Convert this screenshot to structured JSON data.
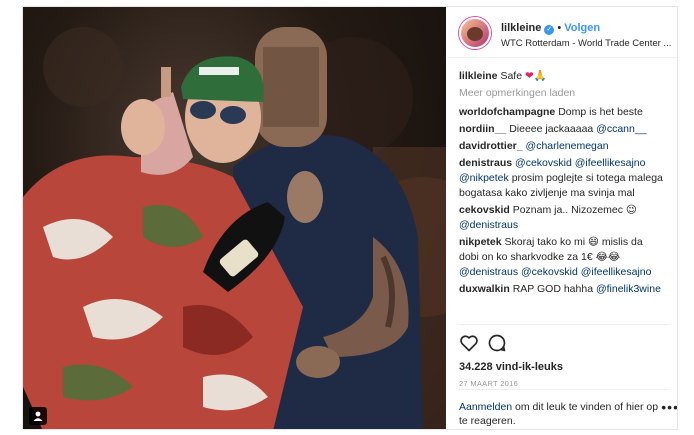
{
  "header": {
    "username": "lilkleine",
    "verified_glyph": "✓",
    "separator": "•",
    "follow_label": "Volgen",
    "location": "WTC Rotterdam - World Trade Center ..."
  },
  "caption": {
    "user": "lilkleine",
    "text": "Safe",
    "heart": "❤",
    "emoji": "🙏"
  },
  "load_more_label": "Meer opmerkingen laden",
  "comments": [
    {
      "user": "worldofchampagne",
      "text": "Domp is het beste"
    },
    {
      "user": "nordiin__",
      "text": "Dieeee jackaaaaa ",
      "mention": "@ccann__"
    },
    {
      "user": "davidrottier_",
      "text": "",
      "mention": "@charlenemegan"
    },
    {
      "user": "denistraus",
      "mention": "@cekovskid @ifeellikesajno @nikpetek",
      "text": " prosim poglejte si totega malega bogatasa kako zivljenje ma svinja mal"
    },
    {
      "user": "cekovskid",
      "text": "Poznam ja.. Nizozemec 😉 ",
      "mention": "@denistraus"
    },
    {
      "user": "nikpetek",
      "text": "Skoraj tako ko mi 😄 mislis da dobi on ko sharkvodke za 1€ 😂😂 ",
      "mention": "@denistraus @cekovskid @ifeellikesajno"
    },
    {
      "user": "duxwalkin",
      "text": "RAP GOD hahha ",
      "mention": "@finelik3wine"
    },
    {
      "user": "",
      "text": "",
      "mention": ""
    }
  ],
  "likes_label": "34.228 vind-ik-leuks",
  "date_label": "27 maart 2016",
  "login": {
    "link": "Aanmelden",
    "text": " om dit leuk te vinden of hier op te reageren."
  },
  "more_glyph": "•••",
  "icons": {
    "like": "heart-outline-icon",
    "comment": "comment-bubble-icon",
    "tag": "person-tag-icon",
    "more": "more-options-icon"
  },
  "colors": {
    "accent": "#3897f0",
    "mention": "#003569",
    "muted": "#999999",
    "heart": "#e0245e"
  }
}
